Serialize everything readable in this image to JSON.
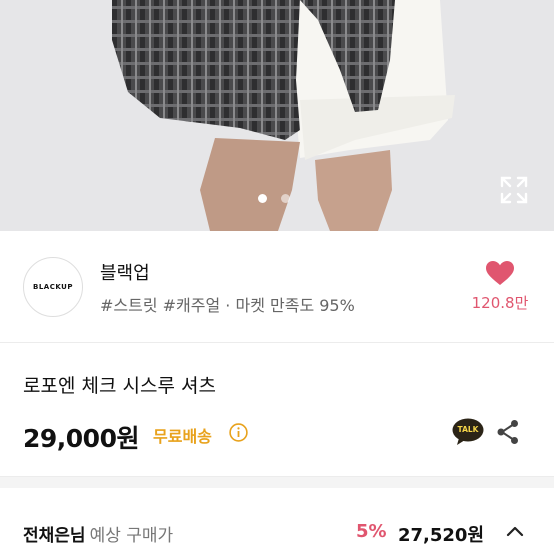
{
  "gallery": {
    "page_count": 2,
    "active_index": 0,
    "expand_icon": "expand-icon"
  },
  "shop": {
    "logo_text": "BLACKUP",
    "name": "블랙업",
    "meta": "#스트릿 #캐주얼 · 마켓 만족도 95%",
    "like_count": "120.8만",
    "like_icon": "heart-icon",
    "accent_color": "#e0566f"
  },
  "product": {
    "title": "로포엔 체크 시스루 셔츠",
    "price": "29,000원",
    "shipping_badge": "무료배송",
    "shipping_color": "#e8a21c",
    "talk_label": "TALK",
    "share_icon": "share-icon"
  },
  "purchase": {
    "buyer_label": "전채은님",
    "label_suffix": "예상 구매가",
    "discount": "5%",
    "price": "27,520원",
    "toggle_icon": "chevron-up-icon"
  }
}
